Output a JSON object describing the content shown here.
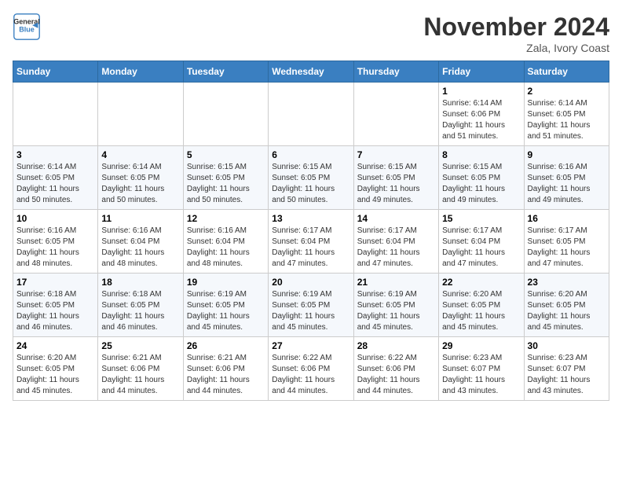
{
  "header": {
    "logo_line1": "General",
    "logo_line2": "Blue",
    "month_title": "November 2024",
    "location": "Zala, Ivory Coast"
  },
  "weekdays": [
    "Sunday",
    "Monday",
    "Tuesday",
    "Wednesday",
    "Thursday",
    "Friday",
    "Saturday"
  ],
  "weeks": [
    [
      {
        "day": "",
        "info": ""
      },
      {
        "day": "",
        "info": ""
      },
      {
        "day": "",
        "info": ""
      },
      {
        "day": "",
        "info": ""
      },
      {
        "day": "",
        "info": ""
      },
      {
        "day": "1",
        "info": "Sunrise: 6:14 AM\nSunset: 6:06 PM\nDaylight: 11 hours\nand 51 minutes."
      },
      {
        "day": "2",
        "info": "Sunrise: 6:14 AM\nSunset: 6:05 PM\nDaylight: 11 hours\nand 51 minutes."
      }
    ],
    [
      {
        "day": "3",
        "info": "Sunrise: 6:14 AM\nSunset: 6:05 PM\nDaylight: 11 hours\nand 50 minutes."
      },
      {
        "day": "4",
        "info": "Sunrise: 6:14 AM\nSunset: 6:05 PM\nDaylight: 11 hours\nand 50 minutes."
      },
      {
        "day": "5",
        "info": "Sunrise: 6:15 AM\nSunset: 6:05 PM\nDaylight: 11 hours\nand 50 minutes."
      },
      {
        "day": "6",
        "info": "Sunrise: 6:15 AM\nSunset: 6:05 PM\nDaylight: 11 hours\nand 50 minutes."
      },
      {
        "day": "7",
        "info": "Sunrise: 6:15 AM\nSunset: 6:05 PM\nDaylight: 11 hours\nand 49 minutes."
      },
      {
        "day": "8",
        "info": "Sunrise: 6:15 AM\nSunset: 6:05 PM\nDaylight: 11 hours\nand 49 minutes."
      },
      {
        "day": "9",
        "info": "Sunrise: 6:16 AM\nSunset: 6:05 PM\nDaylight: 11 hours\nand 49 minutes."
      }
    ],
    [
      {
        "day": "10",
        "info": "Sunrise: 6:16 AM\nSunset: 6:05 PM\nDaylight: 11 hours\nand 48 minutes."
      },
      {
        "day": "11",
        "info": "Sunrise: 6:16 AM\nSunset: 6:04 PM\nDaylight: 11 hours\nand 48 minutes."
      },
      {
        "day": "12",
        "info": "Sunrise: 6:16 AM\nSunset: 6:04 PM\nDaylight: 11 hours\nand 48 minutes."
      },
      {
        "day": "13",
        "info": "Sunrise: 6:17 AM\nSunset: 6:04 PM\nDaylight: 11 hours\nand 47 minutes."
      },
      {
        "day": "14",
        "info": "Sunrise: 6:17 AM\nSunset: 6:04 PM\nDaylight: 11 hours\nand 47 minutes."
      },
      {
        "day": "15",
        "info": "Sunrise: 6:17 AM\nSunset: 6:04 PM\nDaylight: 11 hours\nand 47 minutes."
      },
      {
        "day": "16",
        "info": "Sunrise: 6:17 AM\nSunset: 6:05 PM\nDaylight: 11 hours\nand 47 minutes."
      }
    ],
    [
      {
        "day": "17",
        "info": "Sunrise: 6:18 AM\nSunset: 6:05 PM\nDaylight: 11 hours\nand 46 minutes."
      },
      {
        "day": "18",
        "info": "Sunrise: 6:18 AM\nSunset: 6:05 PM\nDaylight: 11 hours\nand 46 minutes."
      },
      {
        "day": "19",
        "info": "Sunrise: 6:19 AM\nSunset: 6:05 PM\nDaylight: 11 hours\nand 45 minutes."
      },
      {
        "day": "20",
        "info": "Sunrise: 6:19 AM\nSunset: 6:05 PM\nDaylight: 11 hours\nand 45 minutes."
      },
      {
        "day": "21",
        "info": "Sunrise: 6:19 AM\nSunset: 6:05 PM\nDaylight: 11 hours\nand 45 minutes."
      },
      {
        "day": "22",
        "info": "Sunrise: 6:20 AM\nSunset: 6:05 PM\nDaylight: 11 hours\nand 45 minutes."
      },
      {
        "day": "23",
        "info": "Sunrise: 6:20 AM\nSunset: 6:05 PM\nDaylight: 11 hours\nand 45 minutes."
      }
    ],
    [
      {
        "day": "24",
        "info": "Sunrise: 6:20 AM\nSunset: 6:05 PM\nDaylight: 11 hours\nand 45 minutes."
      },
      {
        "day": "25",
        "info": "Sunrise: 6:21 AM\nSunset: 6:06 PM\nDaylight: 11 hours\nand 44 minutes."
      },
      {
        "day": "26",
        "info": "Sunrise: 6:21 AM\nSunset: 6:06 PM\nDaylight: 11 hours\nand 44 minutes."
      },
      {
        "day": "27",
        "info": "Sunrise: 6:22 AM\nSunset: 6:06 PM\nDaylight: 11 hours\nand 44 minutes."
      },
      {
        "day": "28",
        "info": "Sunrise: 6:22 AM\nSunset: 6:06 PM\nDaylight: 11 hours\nand 44 minutes."
      },
      {
        "day": "29",
        "info": "Sunrise: 6:23 AM\nSunset: 6:07 PM\nDaylight: 11 hours\nand 43 minutes."
      },
      {
        "day": "30",
        "info": "Sunrise: 6:23 AM\nSunset: 6:07 PM\nDaylight: 11 hours\nand 43 minutes."
      }
    ]
  ]
}
